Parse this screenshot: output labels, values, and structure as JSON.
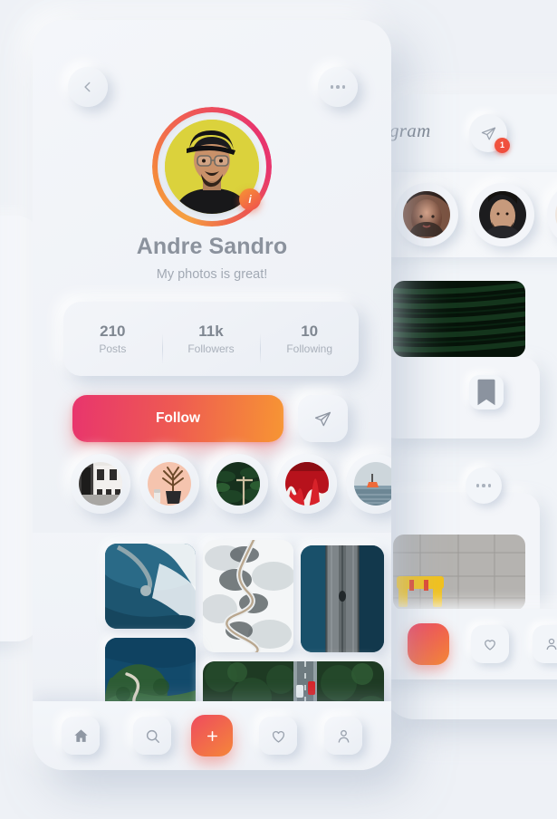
{
  "theme": {
    "background": "#eef1f6",
    "card_surface": "#f2f5f9",
    "accent_pink": "#e8356d",
    "accent_orange": "#f79533",
    "text_primary": "#8b929d",
    "text_secondary": "#a2a9b4",
    "badge_red": "#ef4a3c"
  },
  "profile_card": {
    "header": {
      "back_label": "Back",
      "back_icon": "chevron-left-icon",
      "more_label": "More options",
      "more_icon": "ellipsis-icon"
    },
    "avatar": {
      "alt": "Andre Sandro profile photo",
      "badge_text": "i",
      "ring_gradient_from": "#e8356d",
      "ring_gradient_to": "#f7a040"
    },
    "name": "Andre Sandro",
    "bio": "My photos is great!",
    "stats": [
      {
        "value": "210",
        "label": "Posts"
      },
      {
        "value": "11k",
        "label": "Followers"
      },
      {
        "value": "10",
        "label": "Following"
      }
    ],
    "actions": {
      "follow_label": "Follow",
      "send_label": "Send message",
      "send_icon": "paper-plane-icon"
    },
    "highlights": [
      {
        "name": "highlight-street",
        "alt": "Black and white street cafe"
      },
      {
        "name": "highlight-plant",
        "alt": "Potted plant on peach background"
      },
      {
        "name": "highlight-jungle",
        "alt": "Dark green jungle foliage"
      },
      {
        "name": "highlight-red",
        "alt": "Red paint abstract"
      },
      {
        "name": "highlight-sea",
        "alt": "Boat on open sea"
      }
    ],
    "grid": [
      {
        "name": "photo-coastal-road",
        "alt": "Aerial view of road curving into fog over blue water"
      },
      {
        "name": "photo-snow-river",
        "alt": "Aerial view of winding river through snow"
      },
      {
        "name": "photo-bridge",
        "alt": "Aerial view of bridge over dark water"
      },
      {
        "name": "photo-island-road",
        "alt": "Aerial view of winding road on green island"
      },
      {
        "name": "photo-forest-highway",
        "alt": "Aerial view of highway through pine forest with red car"
      }
    ],
    "bottom_nav": [
      {
        "name": "nav-home",
        "label": "Home",
        "icon": "home-icon",
        "active": true
      },
      {
        "name": "nav-search",
        "label": "Search",
        "icon": "search-icon",
        "active": false
      },
      {
        "name": "nav-create",
        "label": "Create",
        "icon": "plus-icon",
        "active": false
      },
      {
        "name": "nav-likes",
        "label": "Likes",
        "icon": "heart-icon",
        "active": false
      },
      {
        "name": "nav-profile",
        "label": "Profile",
        "icon": "person-icon",
        "active": false
      }
    ]
  },
  "feed_card": {
    "logo_text": "gram",
    "send_icon": "paper-plane-icon",
    "send_badge": "1",
    "stories": [
      {
        "name": "story-avatar-1",
        "alt": "Woman with dark hair"
      },
      {
        "name": "story-avatar-2",
        "alt": "Man with beard"
      },
      {
        "name": "story-avatar-3",
        "alt": "Woman in profile"
      }
    ],
    "posts": [
      {
        "name": "feed-post-palm",
        "alt": "Dark green palm leaves",
        "action_icon": "bookmark-icon"
      },
      {
        "name": "feed-post-street",
        "alt": "Yellow barrier on concrete",
        "action_icon": "ellipsis-icon"
      }
    ],
    "bottom_nav": [
      {
        "name": "feed-nav-create",
        "label": "Create",
        "icon": "plus-icon"
      },
      {
        "name": "feed-nav-likes",
        "label": "Likes",
        "icon": "heart-icon"
      },
      {
        "name": "feed-nav-profile",
        "label": "Profile",
        "icon": "person-icon"
      }
    ]
  }
}
